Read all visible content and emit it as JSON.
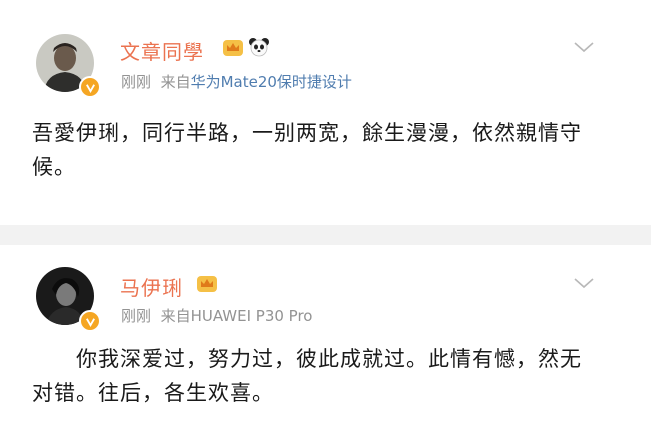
{
  "posts": [
    {
      "username": "文章同學",
      "time": "刚刚",
      "from_prefix": "来自",
      "source": "华为Mate20保时捷设计",
      "text": "吾愛伊琍，同行半路，一别两宽，餘生漫漫，依然親情守候。",
      "badges": [
        "crown-icon",
        "panda-icon"
      ]
    },
    {
      "username": "马伊琍",
      "time": "刚刚",
      "from_prefix": "来自",
      "source": "HUAWEI P30 Pro",
      "text": "你我深爱过，努力过，彼此成就过。此情有憾，然无对错。往后，各生欢喜。",
      "badges": [
        "crown-icon"
      ]
    }
  ],
  "colors": {
    "username": "#eb7350",
    "meta": "#939393",
    "source_link": "#507daf",
    "verified_badge": "#f5a623"
  }
}
